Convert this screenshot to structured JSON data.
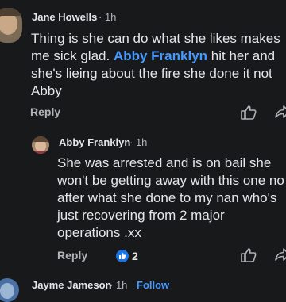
{
  "comments": [
    {
      "author": "Jane Howells",
      "time": "· 1h",
      "lines": [
        "Thing is she can do what she likes makes",
        "me sick glad.",
        "Abby Franklyn",
        "hit her and",
        "she's lieing about the fire she done it not",
        "Abby"
      ],
      "reply_label": "Reply"
    },
    {
      "author": "Abby Franklyn",
      "time": "· 1h",
      "lines": [
        "She was arrested and is  on bail she",
        "won't be getting away with this one no",
        "after what she done to my nan who's",
        "just recovering from 2 major",
        "operations .xx"
      ],
      "reply_label": "Reply",
      "reaction_count": "2"
    },
    {
      "author": "Jayme Jameson",
      "time": "· 1h",
      "follow_label": "Follow"
    }
  ],
  "colors": {
    "background": "#18191a",
    "text": "#e4e6eb",
    "muted": "#b0b3b8",
    "mention": "#4599ff",
    "like_badge": "#1b74e4"
  }
}
